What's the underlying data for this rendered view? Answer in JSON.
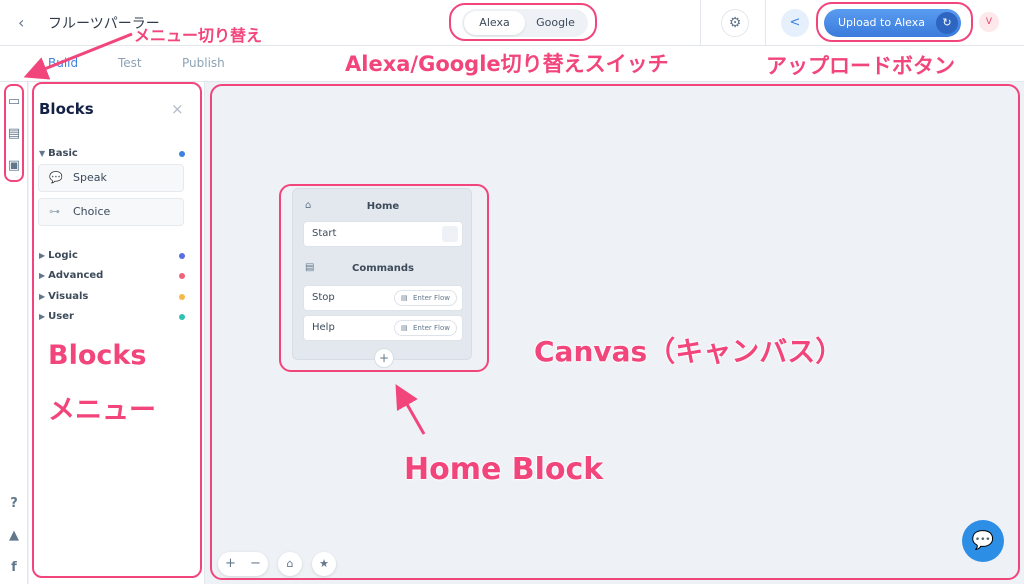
{
  "header": {
    "back_icon": "chevron-left",
    "project_title": "フルーツパーラー",
    "platform_options": [
      "Alexa",
      "Google"
    ],
    "platform_active": "Alexa",
    "settings_icon": "gear",
    "share_icon": "share",
    "upload_label": "Upload to Alexa",
    "upload_icon": "sync",
    "avatar_initial": "V"
  },
  "tabs": [
    "Build",
    "Test",
    "Publish"
  ],
  "active_tab": "Build",
  "rail": {
    "icons": [
      "monitor-icon",
      "library-icon",
      "terminal-icon"
    ],
    "bottom_icons": [
      "help-icon",
      "graduation-cap-icon",
      "facebook-icon"
    ],
    "help_glyph": "?",
    "facebook_glyph": "f"
  },
  "blocks_panel": {
    "title": "Blocks",
    "close_glyph": "×",
    "basic_section": "Basic",
    "basic_items": [
      "Speak",
      "Choice"
    ],
    "sections": [
      {
        "label": "Logic",
        "color": "#5b6ee1"
      },
      {
        "label": "Advanced",
        "color": "#f0637a"
      },
      {
        "label": "Visuals",
        "color": "#f5b94a"
      },
      {
        "label": "User",
        "color": "#2cc3b5"
      }
    ],
    "basic_color": "#3d82e2"
  },
  "canvas": {
    "home_block": {
      "title": "Home",
      "start_label": "Start",
      "commands_title": "Commands",
      "commands": [
        {
          "label": "Stop",
          "action": "Enter Flow"
        },
        {
          "label": "Help",
          "action": "Enter Flow"
        }
      ],
      "add_glyph": "+"
    },
    "zoom_in": "+",
    "zoom_out": "−",
    "home_icon": "home",
    "star_icon": "star",
    "chat_icon": "chat"
  },
  "annotations": {
    "menu_toggle": "メニュー切り替え",
    "platform_switch": "Alexa/Google切り替えスイッチ",
    "upload_button": "アップロードボタン",
    "blocks_menu_line1": "Blocks",
    "blocks_menu_line2": "メニュー",
    "canvas": "Canvas（キャンバス）",
    "home_block": "Home Block"
  },
  "colors": {
    "annotation": "#f1457c",
    "accent": "#3d82e2"
  }
}
